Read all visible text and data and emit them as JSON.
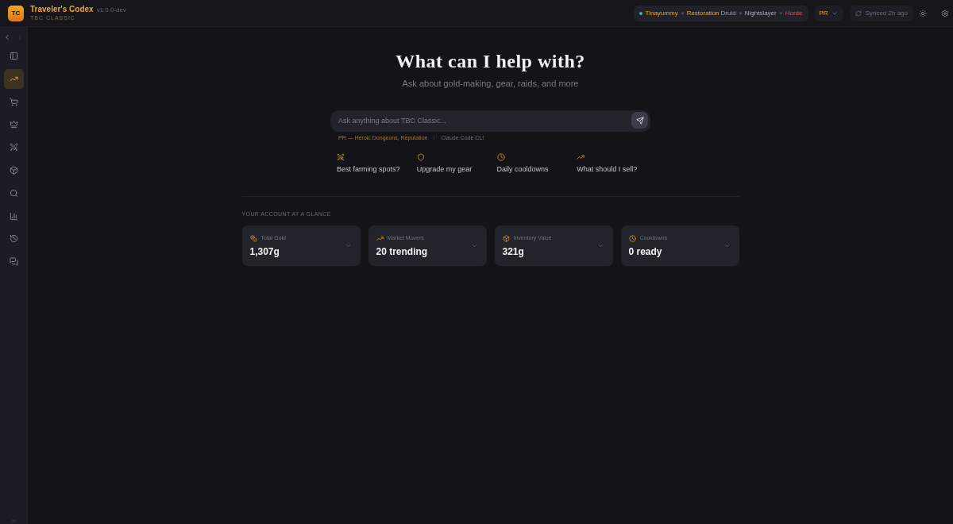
{
  "app": {
    "logo": "TC",
    "name": "Traveler's Codex",
    "version": "v1.0.0-dev",
    "edition": "TBC CLASSIC"
  },
  "character": {
    "online": true,
    "name": "Tinayummy",
    "spec": "Restoration",
    "class": "Druid",
    "realm": "Nightslayer",
    "faction": "Horde"
  },
  "profile": {
    "label": "PR"
  },
  "sync": {
    "label": "Synced 2h ago"
  },
  "nav": {
    "back": {
      "disabled": false
    },
    "forward": {
      "disabled": true
    }
  },
  "sidebar": {
    "items": [
      {
        "kind": "panel",
        "selected": false
      },
      {
        "kind": "trending",
        "selected": true
      },
      {
        "kind": "cart",
        "selected": false
      },
      {
        "kind": "crown",
        "selected": false
      },
      {
        "kind": "swords",
        "selected": false
      },
      {
        "kind": "box",
        "selected": false
      },
      {
        "kind": "search",
        "selected": false
      },
      {
        "kind": "chart",
        "selected": false
      },
      {
        "kind": "history",
        "selected": false
      },
      {
        "kind": "messages",
        "selected": false
      }
    ]
  },
  "hero": {
    "title": "What can I help with?",
    "subtitle": "Ask about gold-making, gear, raids, and more"
  },
  "search": {
    "placeholder": "Ask anything about TBC Classic..."
  },
  "context": {
    "profile": "PR — Heroic Dungeons, Reputation",
    "model": "Claude Code CLI"
  },
  "suggestions": [
    {
      "kind": "swords",
      "label": "Best farming spots?"
    },
    {
      "kind": "shield",
      "label": "Upgrade my gear"
    },
    {
      "kind": "clock",
      "label": "Daily cooldowns"
    },
    {
      "kind": "trending",
      "label": "What should I sell?"
    }
  ],
  "account": {
    "heading": "YOUR ACCOUNT AT A GLANCE",
    "cards": [
      {
        "kind": "coins",
        "label": "Total Gold",
        "value": "1,307g",
        "expanded": false
      },
      {
        "kind": "trending",
        "label": "Market Movers",
        "value": "20 trending",
        "expanded": false
      },
      {
        "kind": "box",
        "label": "Inventory Value",
        "value": "321g",
        "expanded": false
      },
      {
        "kind": "clock",
        "label": "Cooldowns",
        "value": "0 ready",
        "expanded": false
      }
    ]
  }
}
